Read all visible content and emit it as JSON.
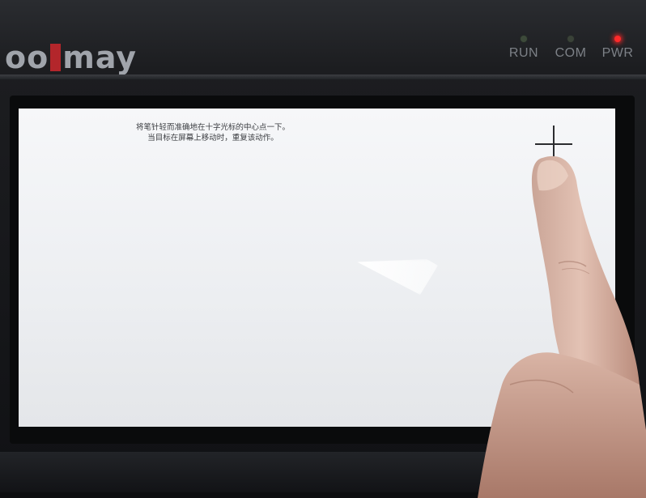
{
  "device": {
    "brand_left": "oo",
    "brand_right": "may",
    "accent_color": "#b3262b",
    "leds": [
      {
        "label": "RUN",
        "color": "#3d4a3a"
      },
      {
        "label": "COM",
        "color": "#3a4238"
      },
      {
        "label": "PWR",
        "color": "#ff2a2a"
      }
    ]
  },
  "screen": {
    "instruction_line1": "将笔针轻而准确地在十字光标的中心点一下。",
    "instruction_line2": "当目标在屏幕上移动时，重复该动作。",
    "target_icon": "crosshair-icon"
  }
}
